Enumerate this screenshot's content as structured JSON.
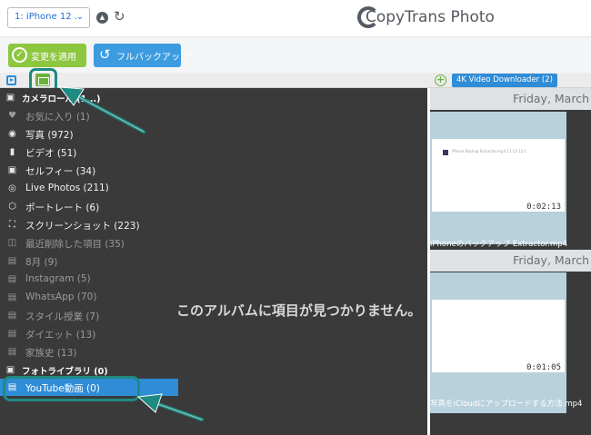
{
  "topbar": {
    "device_label": "1: iPhone 12 ...",
    "logo_text": "CopyTrans Photo"
  },
  "toolbar": {
    "apply_label": "変更を適用",
    "backup_label": "フルバックアップ"
  },
  "right_header": {
    "tab_label": "4K Video Downloader (2)"
  },
  "sidebar": {
    "items": [
      {
        "icon": "camera-icon",
        "label": "カメラロール (1...)"
      },
      {
        "icon": "heart-icon",
        "label": "お気に入り (1)"
      },
      {
        "icon": "photo-icon",
        "label": "写真 (972)"
      },
      {
        "icon": "video-icon",
        "label": "ビデオ (51)"
      },
      {
        "icon": "selfie-icon",
        "label": "セルフィー (34)"
      },
      {
        "icon": "live-photos-icon",
        "label": "Live Photos (211)"
      },
      {
        "icon": "portrait-icon",
        "label": "ポートレート (6)"
      },
      {
        "icon": "screenshot-icon",
        "label": "スクリーンショット (223)"
      },
      {
        "icon": "trash-icon",
        "label": "最近削除した項目 (35)"
      },
      {
        "icon": "album-icon",
        "label": "8月 (9)"
      },
      {
        "icon": "album-icon",
        "label": "Instagram (5)"
      },
      {
        "icon": "album-icon",
        "label": "WhatsApp (70)"
      },
      {
        "icon": "album-icon",
        "label": "スタイル授業 (7)"
      },
      {
        "icon": "album-icon",
        "label": "ダイエット (13)"
      },
      {
        "icon": "album-icon",
        "label": "家族史 (13)"
      },
      {
        "icon": "camera-icon",
        "label": "フォトライブラリ (0)"
      },
      {
        "icon": "album-icon",
        "label": "YouTube動画 (0)"
      }
    ]
  },
  "middle": {
    "empty_message": "このアルバムに項目が見つかりません。"
  },
  "right_panel": {
    "groups": [
      {
        "date": "Friday, March",
        "thumb_title": "iPhone Backup Extractor.mp4 11:13 12:1",
        "duration": "0:02:13",
        "caption": "iPhoneのバックアップ   Extractor.mp4"
      },
      {
        "date": "Friday, March",
        "thumb_title": "",
        "duration": "0:01:05",
        "caption": "写真をiCloudにアップロードする方法.mp4"
      }
    ]
  },
  "colors": {
    "accent_blue": "#2f8cd6",
    "apply_green": "#8dc63f",
    "highlight_teal": "#1e8a82",
    "panel_dark": "#3a3a3a"
  }
}
